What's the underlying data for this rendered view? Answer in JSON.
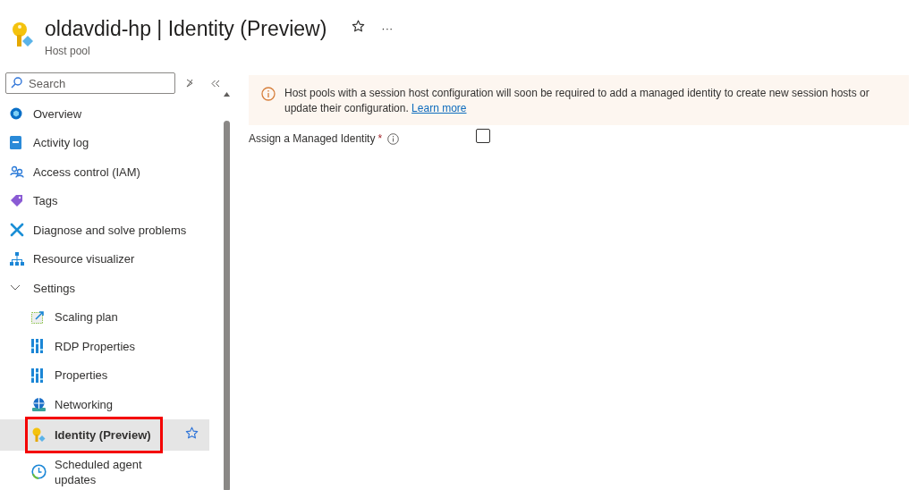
{
  "header": {
    "title": "oldavdid-hp | Identity (Preview)",
    "subtitle": "Host pool",
    "favorite": false,
    "more": "···"
  },
  "sidebar": {
    "search": {
      "placeholder": "Search"
    },
    "items": [
      {
        "label": "Overview",
        "kind": "overview",
        "selected": false
      },
      {
        "label": "Activity log",
        "kind": "log",
        "selected": false
      },
      {
        "label": "Access control (IAM)",
        "kind": "iam",
        "selected": false
      },
      {
        "label": "Tags",
        "kind": "tags",
        "selected": false
      },
      {
        "label": "Diagnose and solve problems",
        "kind": "diagnose",
        "selected": false
      },
      {
        "label": "Resource visualizer",
        "kind": "visualizer",
        "selected": false
      },
      {
        "label": "Settings",
        "kind": "group",
        "expanded": true,
        "selected": false,
        "children": [
          {
            "label": "Scaling plan",
            "kind": "scaling",
            "selected": false
          },
          {
            "label": "RDP Properties",
            "kind": "properties",
            "selected": false
          },
          {
            "label": "Properties",
            "kind": "properties",
            "selected": false
          },
          {
            "label": "Networking",
            "kind": "networking",
            "selected": false
          },
          {
            "label": "Identity (Preview)",
            "kind": "identity",
            "selected": true
          },
          {
            "label": "Scheduled agent updates",
            "kind": "schedule",
            "selected": false
          }
        ]
      }
    ]
  },
  "content": {
    "notice": {
      "text": "Host pools with a session host configuration will soon be required to add a managed identity to create new session hosts or update their configuration.",
      "link": "Learn more"
    },
    "field": {
      "label": "Assign a Managed Identity",
      "required_mark": "*",
      "checked": false
    }
  }
}
